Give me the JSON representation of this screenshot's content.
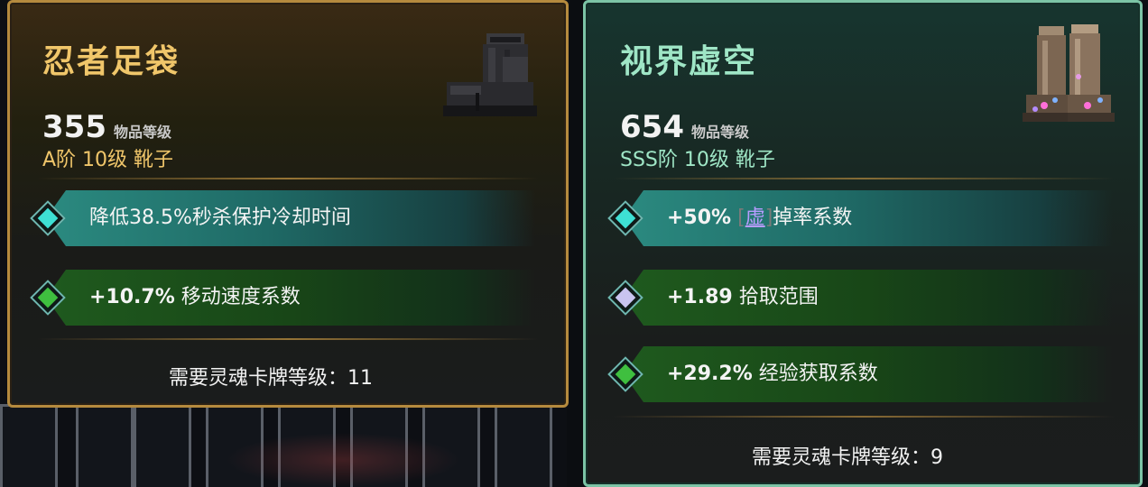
{
  "cards": [
    {
      "title": "忍者足袋",
      "level": "355",
      "level_label": "物品等级",
      "tier": "A阶 10级 靴子",
      "item_icon": "black-tabi-boots-icon",
      "affixes": [
        {
          "gem": "teal-diamond-gem-icon",
          "text": "降低38.5%秒杀保护冷却时间"
        },
        {
          "gem": "green-diamond-gem-icon",
          "value": "+10.7%",
          "text": "移动速度系数"
        }
      ],
      "requirement": "需要灵魂卡牌等级：11",
      "accent": "#f0c66a"
    },
    {
      "title": "视界虚空",
      "level": "654",
      "level_label": "物品等级",
      "tier": "SSS阶 10级 靴子",
      "item_icon": "jeweled-brown-boots-icon",
      "affixes": [
        {
          "gem": "teal-diamond-gem-icon",
          "value": "+50%",
          "tag_open": "[",
          "tag": "虚",
          "tag_close": "]",
          "text": "掉率系数"
        },
        {
          "gem": "lilac-diamond-gem-icon",
          "value": "+1.89",
          "text": "拾取范围"
        },
        {
          "gem": "green-diamond-gem-icon",
          "value": "+29.2%",
          "text": "经验获取系数"
        }
      ],
      "requirement": "需要灵魂卡牌等级：9",
      "accent": "#9fe6c6"
    }
  ]
}
